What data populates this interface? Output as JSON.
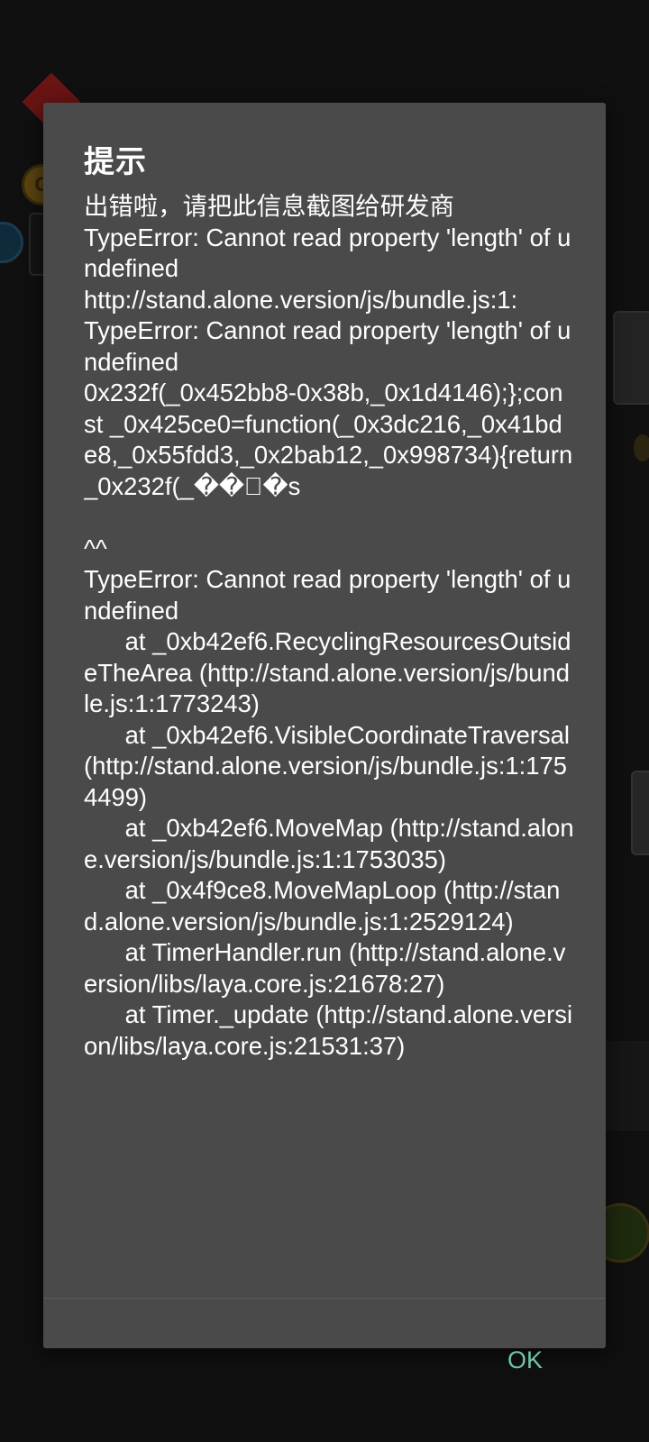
{
  "dialog": {
    "title": "提示",
    "message": "出错啦，请把此信息截图给研发商\nTypeError: Cannot read property 'length' of undefined\nhttp://stand.alone.version/js/bundle.js:1:\nTypeError: Cannot read property 'length' of undefined\n0x232f(_0x452bb8-0x38b,_0x1d4146);};const _0x425ce0=function(_0x3dc216,_0x41bde8,_0x55fdd3,_0x2bab12,_0x998734){return _0x232f(_��\u0000�s\n\n^^\nTypeError: Cannot read property 'length' of undefined\n      at _0xb42ef6.RecyclingResourcesOutsideTheArea (http://stand.alone.version/js/bundle.js:1:1773243)\n      at _0xb42ef6.VisibleCoordinateTraversal (http://stand.alone.version/js/bundle.js:1:1754499)\n      at _0xb42ef6.MoveMap (http://stand.alone.version/js/bundle.js:1:1753035)\n      at _0x4f9ce8.MoveMapLoop (http://stand.alone.version/js/bundle.js:1:2529124)\n      at TimerHandler.run (http://stand.alone.version/libs/laya.core.js:21678:27)\n      at Timer._update (http://stand.alone.version/libs/laya.core.js:21531:37)",
    "ok_label": "OK"
  },
  "background": {
    "coin_icon": "coin-icon",
    "accent_color": "#6fc3ad",
    "dialog_bg": "#4a4a4a"
  }
}
